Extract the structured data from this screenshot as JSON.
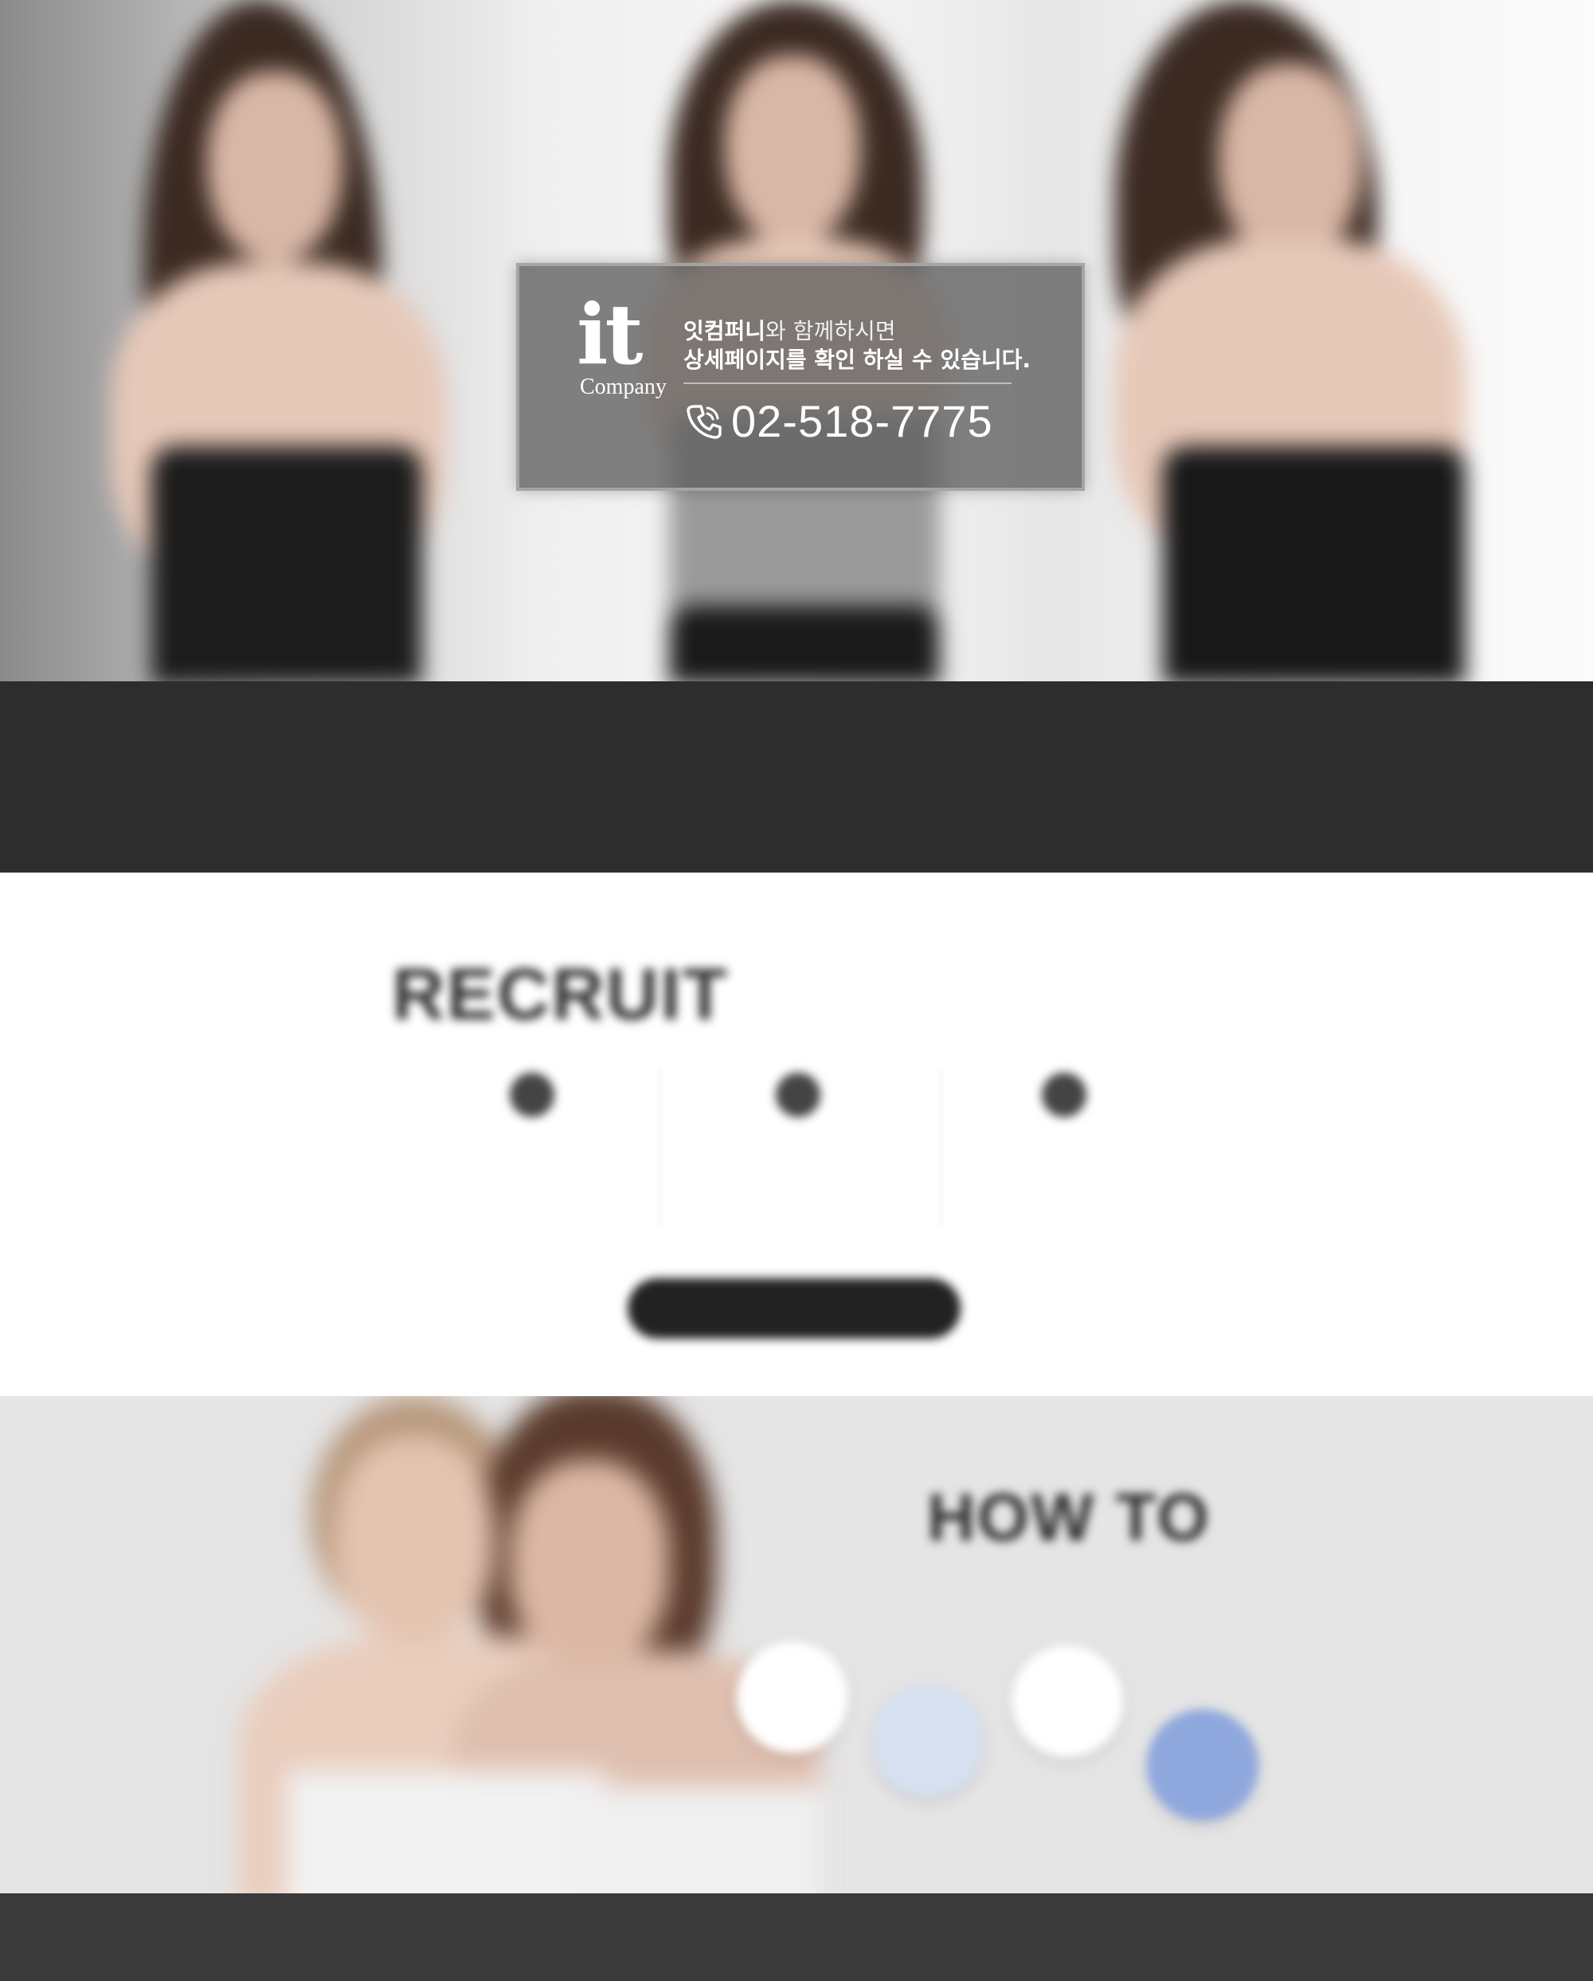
{
  "popup": {
    "logo_main": "it",
    "logo_sub": "Company",
    "message_line1_bold": "잇컴퍼니",
    "message_line1_rest": "와 함께하시면",
    "message_line2": "상세페이지를 확인 하실 수 있습니다.",
    "phone": "02-518-7775",
    "phone_icon": "phone-icon"
  },
  "band": {
    "line1": "",
    "line2": "",
    "line3": ""
  },
  "recruit": {
    "title": "RECRUIT",
    "features": [
      {
        "icon": "document-icon",
        "title": "",
        "desc": ""
      },
      {
        "icon": "person-icon",
        "title": "",
        "desc": ""
      },
      {
        "icon": "chat-icon",
        "title": "",
        "desc": ""
      }
    ],
    "cta_label": ""
  },
  "howto": {
    "title": "HOW TO",
    "subtitle": "",
    "circles": [
      {
        "label": "",
        "style": "white"
      },
      {
        "label": "",
        "style": "pale-blue"
      },
      {
        "label": "",
        "style": "white"
      },
      {
        "label": "",
        "style": "blue"
      }
    ]
  },
  "footer": {
    "line1": "",
    "line2": ""
  },
  "colors": {
    "dark_band": "#2d2d2d",
    "accent_blue": "#8ea7dd",
    "footer": "#3a3a3a",
    "howto_bg": "#e5e5e5"
  }
}
